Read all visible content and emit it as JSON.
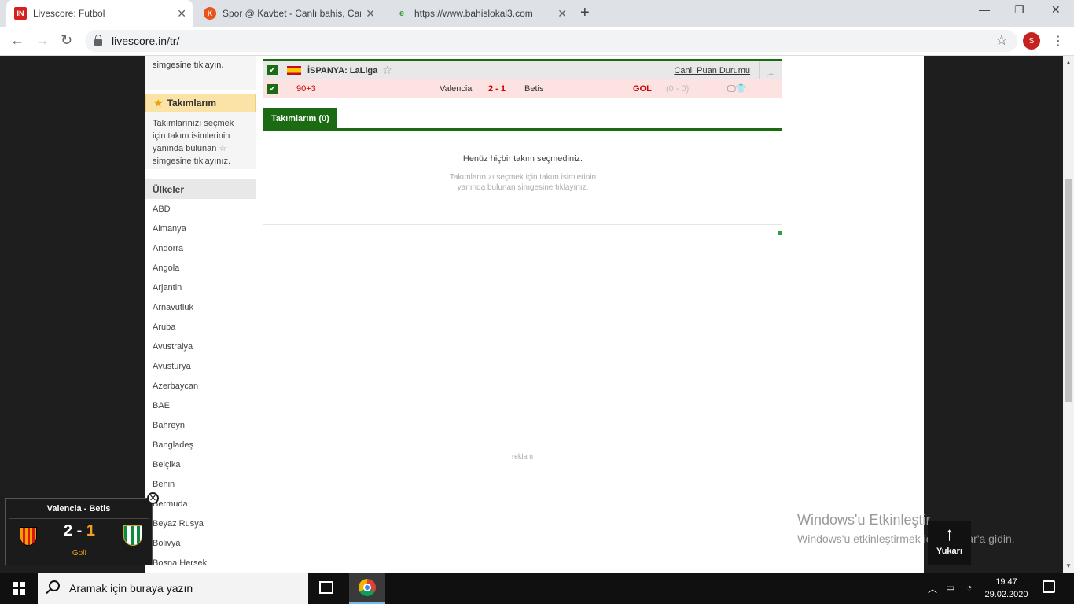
{
  "browser": {
    "tabs": [
      {
        "title": "Livescore: Futbol",
        "favicon": "IN"
      },
      {
        "title": "Spor @ Kavbet - Canlı bahis, Can"
      },
      {
        "title": "https://www.bahislokal3.com"
      }
    ],
    "url": "livescore.in/tr/",
    "profile_initial": "S"
  },
  "sidebar": {
    "top_text": "simgesine tıklayın.",
    "my_teams_title": "Takımlarım",
    "my_teams_help_pre": "Takımlarınızı seçmek için takım isimlerinin yanında bulunan",
    "my_teams_help_post": "simgesine tıklayınız.",
    "countries_title": "Ülkeler",
    "countries": [
      "ABD",
      "Almanya",
      "Andorra",
      "Angola",
      "Arjantin",
      "Arnavutluk",
      "Aruba",
      "Avustralya",
      "Avusturya",
      "Azerbaycan",
      "BAE",
      "Bahreyn",
      "Bangladeş",
      "Belçika",
      "Benin",
      "Bermuda",
      "Beyaz Rusya",
      "Bolivya",
      "Bosna Hersek"
    ]
  },
  "league": {
    "name": "İSPANYA: LaLiga",
    "standings_link": "Canlı Puan Durumu",
    "flag_colors": [
      "#c60b1e",
      "#ffc400"
    ]
  },
  "match": {
    "minute": "90+3",
    "home": "Valencia",
    "score": "2 - 1",
    "away": "Betis",
    "event": "GOL",
    "halftime": "(0 - 0)"
  },
  "my_teams": {
    "tab_label": "Takımlarım (0)",
    "empty_title": "Henüz hiçbir takım seçmediniz.",
    "empty_desc": "Takımlarınızı seçmek için takım isimlerinin yanında bulunan simgesine tıklayınız."
  },
  "ad_label": "reklam",
  "popup": {
    "title": "Valencia - Betis",
    "home_goals": "2",
    "separator": "-",
    "away_goals": "1",
    "status": "Gol!"
  },
  "watermark": {
    "title": "Windows'u Etkinleştir",
    "subtitle": "Windows'u etkinleştirmek için Ayarlar'a gidin."
  },
  "back_to_top": "Yukarı",
  "taskbar": {
    "search_placeholder": "Aramak için buraya yazın",
    "time": "19:47",
    "date": "29.02.2020"
  },
  "colors": {
    "accent_green": "#1a6b12",
    "goal_red": "#cc0000",
    "popup_orange": "#f0a020"
  }
}
